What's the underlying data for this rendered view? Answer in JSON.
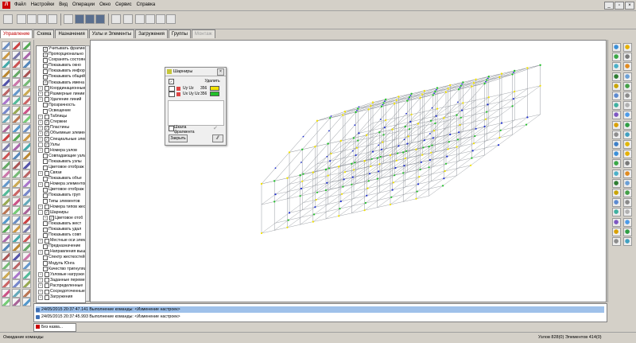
{
  "menu": [
    "Файл",
    "Настройки",
    "Вид",
    "Операции",
    "Окно",
    "Сервис",
    "Справка"
  ],
  "tabs": [
    {
      "label": "Управление",
      "state": "active"
    },
    {
      "label": "Схема",
      "state": "normal"
    },
    {
      "label": "Назначения",
      "state": "normal"
    },
    {
      "label": "Узлы и Элементы",
      "state": "normal"
    },
    {
      "label": "Загружения",
      "state": "normal"
    },
    {
      "label": "Группы",
      "state": "normal"
    },
    {
      "label": "Монтаж",
      "state": "disabled"
    }
  ],
  "tree": [
    {
      "label": "Учитывать фрагмент",
      "checked": true,
      "exp": ""
    },
    {
      "label": "Пропорционально",
      "checked": true,
      "exp": ""
    },
    {
      "label": "Сохранять состояние",
      "checked": false,
      "exp": ""
    },
    {
      "label": "Показывать окно",
      "checked": false,
      "exp": ""
    },
    {
      "label": "Показывать информ",
      "checked": false,
      "exp": ""
    },
    {
      "label": "Показывать общий",
      "checked": false,
      "exp": ""
    },
    {
      "label": "Показывать имена",
      "checked": true,
      "exp": ""
    },
    {
      "label": "Координационные",
      "checked": false,
      "exp": "+"
    },
    {
      "label": "Размерные линии",
      "checked": false,
      "exp": "+"
    },
    {
      "label": "Удаление линий",
      "checked": false,
      "exp": "+"
    },
    {
      "label": "Прозрачность",
      "checked": false,
      "exp": ""
    },
    {
      "label": "Освещение",
      "checked": false,
      "exp": ""
    },
    {
      "label": "Таблицы",
      "checked": false,
      "exp": "+"
    },
    {
      "label": "Стержни",
      "checked": true,
      "exp": "+"
    },
    {
      "label": "Пластины",
      "checked": true,
      "exp": "+"
    },
    {
      "label": "Объемные элементы",
      "checked": true,
      "exp": "+"
    },
    {
      "label": "Специальные элем",
      "checked": true,
      "exp": "+"
    },
    {
      "label": "Узлы",
      "checked": true,
      "exp": "-"
    },
    {
      "label": "Номера узлов",
      "checked": false,
      "exp": "+"
    },
    {
      "label": "Совпадающие узлы",
      "checked": false,
      "exp": ""
    },
    {
      "label": "Показывать узлы",
      "checked": false,
      "exp": ""
    },
    {
      "label": "Цветовое отображ",
      "checked": false,
      "exp": ""
    },
    {
      "label": "Связи",
      "checked": false,
      "exp": "+"
    },
    {
      "label": "Показывать объе",
      "checked": false,
      "exp": ""
    },
    {
      "label": "Номера элементов",
      "checked": false,
      "exp": "+"
    },
    {
      "label": "Цветовое отображ",
      "checked": false,
      "exp": ""
    },
    {
      "label": "Показывать груп",
      "checked": false,
      "exp": ""
    },
    {
      "label": "Типы элементов",
      "checked": false,
      "exp": ""
    },
    {
      "label": "Номера типов жест",
      "checked": false,
      "exp": "+"
    },
    {
      "label": "Шарниры",
      "checked": true,
      "exp": "-"
    },
    {
      "label": "Цветовое отоб",
      "checked": true,
      "exp": "+",
      "indent": true
    },
    {
      "label": "Показывать жест",
      "checked": false,
      "exp": ""
    },
    {
      "label": "Показывать удал",
      "checked": false,
      "exp": ""
    },
    {
      "label": "Показывать совп",
      "checked": false,
      "exp": ""
    },
    {
      "label": "Местные оси элем",
      "checked": false,
      "exp": "+"
    },
    {
      "label": "Предназначение",
      "checked": false,
      "exp": ""
    },
    {
      "label": "Направления выш",
      "checked": false,
      "exp": "+"
    },
    {
      "label": "Спектр жесткостей",
      "checked": false,
      "exp": ""
    },
    {
      "label": "Модуль Юнга",
      "checked": false,
      "exp": ""
    },
    {
      "label": "Качество тригнуляц",
      "checked": false,
      "exp": ""
    },
    {
      "label": "Узловые нагрузки",
      "checked": false,
      "exp": "+"
    },
    {
      "label": "Заданные переме",
      "checked": false,
      "exp": "+"
    },
    {
      "label": "Распределенные",
      "checked": false,
      "exp": "+"
    },
    {
      "label": "Сосредоточенные",
      "checked": false,
      "exp": "+"
    },
    {
      "label": "Загружения",
      "checked": false,
      "exp": "+"
    }
  ],
  "hinges_dialog": {
    "title": "Шарниры",
    "delete_label": "Удалить",
    "rows": [
      {
        "label": "Uy Uz",
        "value": "356",
        "color": "#f2e200"
      },
      {
        "label": "Ux Uy Uz",
        "value": "356",
        "color": "#22c02a"
      }
    ],
    "scale_label": "Шкала",
    "fragment_label": "фрагмента",
    "close_label": "Закрыть"
  },
  "log": [
    {
      "text": "24/05/2015 20:37:47.141 Выполнение команды: <Изменение настроек>",
      "selected": true
    },
    {
      "text": "24/05/2015 20:37:45.993 Выполнение команды: <Изменение настроек>",
      "selected": false
    }
  ],
  "document_tab": "Без назва...",
  "status": {
    "left": "Ожидание команды",
    "right": "Узлов 828(0) Элементов 414(0)"
  },
  "colors": {
    "accent": "#c00000",
    "hinge_yellow": "#f2e200",
    "hinge_green": "#22c02a",
    "node_blue": "#1f2fd0"
  }
}
